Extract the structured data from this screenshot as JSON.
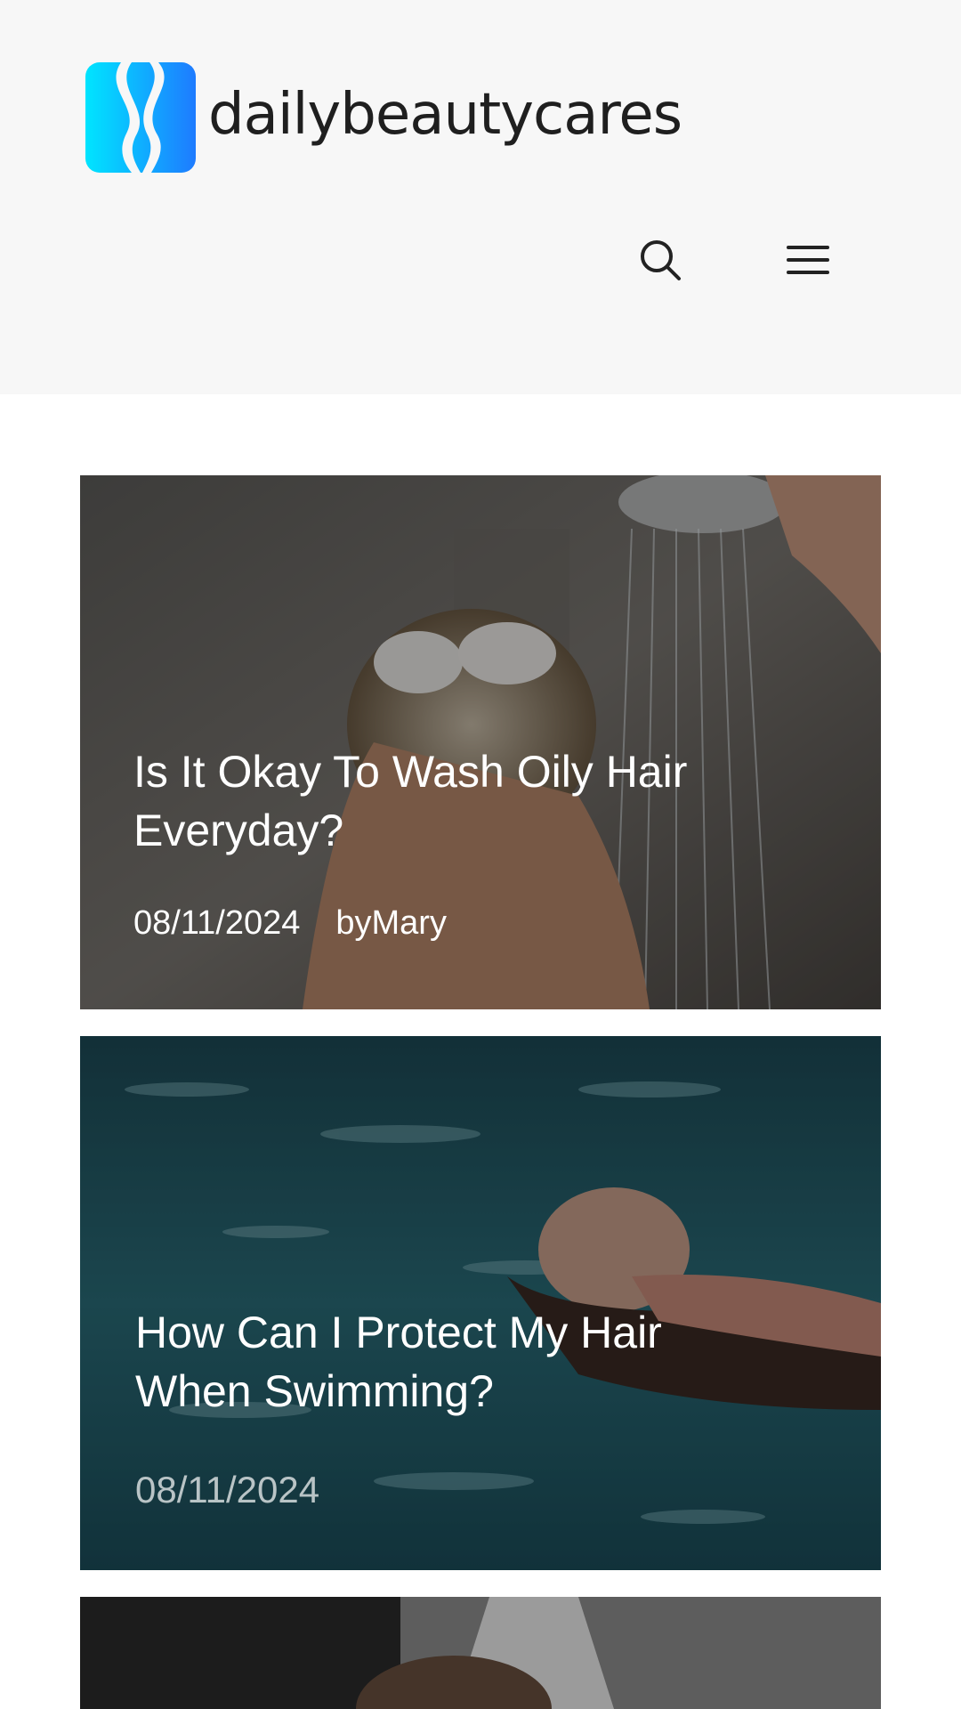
{
  "site": {
    "name": "dailybeautycares",
    "brand_colors": [
      "#00e5ff",
      "#1e7bff"
    ]
  },
  "header": {
    "search_icon": "search-icon",
    "menu_icon": "hamburger-menu-icon"
  },
  "posts": [
    {
      "title": "Is It Okay To Wash Oily Hair Everyday?",
      "date": "08/11/2024",
      "author": "byMary"
    },
    {
      "title": "How Can I Protect My Hair When Swimming?",
      "date": "08/11/2024"
    },
    {
      "title": ""
    }
  ]
}
